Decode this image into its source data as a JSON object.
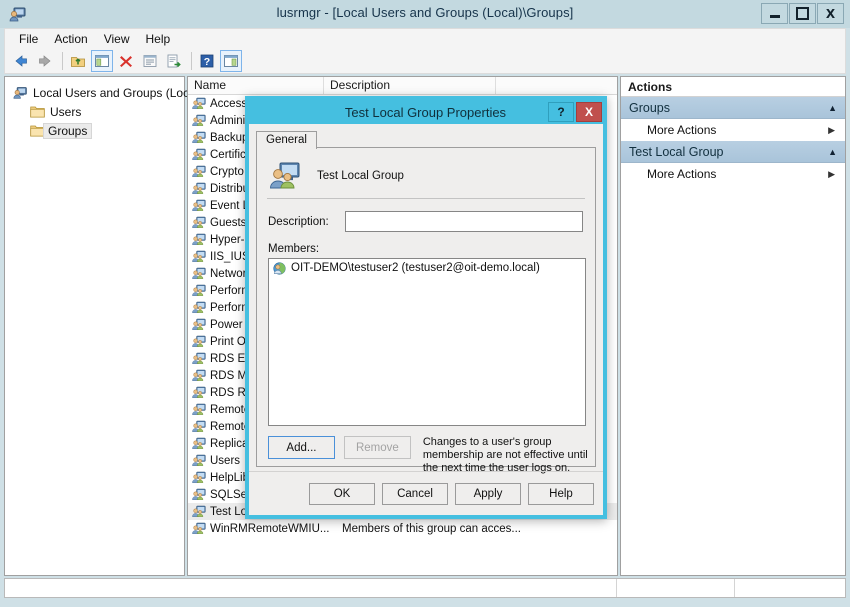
{
  "window": {
    "title": "lusrmgr - [Local Users and Groups (Local)\\Groups]",
    "icon": "users-computer-icon",
    "minimize_label": "Minimize",
    "maximize_label": "Maximize",
    "close_label": "X"
  },
  "menubar": {
    "items": [
      {
        "label": "File"
      },
      {
        "label": "Action"
      },
      {
        "label": "View"
      },
      {
        "label": "Help"
      }
    ]
  },
  "toolbar": {
    "buttons": [
      {
        "name": "back-icon",
        "label": "Back"
      },
      {
        "name": "forward-icon",
        "label": "Forward"
      },
      {
        "name": "up-one-level-icon",
        "label": "Up One Level"
      },
      {
        "name": "show-hide-console-tree-icon",
        "label": "Show/Hide Console Tree"
      },
      {
        "name": "delete-icon",
        "label": "Delete"
      },
      {
        "name": "properties-icon",
        "label": "Properties"
      },
      {
        "name": "export-list-icon",
        "label": "Export List"
      },
      {
        "name": "help-icon",
        "label": "Help"
      },
      {
        "name": "refresh-icon",
        "label": "Refresh"
      }
    ]
  },
  "tree": {
    "root": {
      "label": "Local Users and Groups (Local)",
      "icon": "users-computer-icon"
    },
    "children": [
      {
        "label": "Users",
        "icon": "folder-icon",
        "selected": false
      },
      {
        "label": "Groups",
        "icon": "folder-icon",
        "selected": true
      }
    ]
  },
  "list": {
    "columns": [
      {
        "label": "Name"
      },
      {
        "label": "Description"
      }
    ],
    "rows": [
      {
        "name": "Access",
        "description": "",
        "selected": false
      },
      {
        "name": "Admini",
        "description": "",
        "selected": false
      },
      {
        "name": "Backup",
        "description": "",
        "selected": false
      },
      {
        "name": "Certific",
        "description": "",
        "selected": false
      },
      {
        "name": "Crypto",
        "description": "",
        "selected": false
      },
      {
        "name": "Distribu",
        "description": "",
        "selected": false
      },
      {
        "name": "Event L",
        "description": "",
        "selected": false
      },
      {
        "name": "Guests",
        "description": "",
        "selected": false
      },
      {
        "name": "Hyper-",
        "description": "",
        "selected": false
      },
      {
        "name": "IIS_IUSR",
        "description": "",
        "selected": false
      },
      {
        "name": "Networ",
        "description": "",
        "selected": false
      },
      {
        "name": "Perform",
        "description": "",
        "selected": false
      },
      {
        "name": "Perform",
        "description": "",
        "selected": false
      },
      {
        "name": "Power ",
        "description": "",
        "selected": false
      },
      {
        "name": "Print O",
        "description": "",
        "selected": false
      },
      {
        "name": "RDS En",
        "description": "",
        "selected": false
      },
      {
        "name": "RDS Ma",
        "description": "",
        "selected": false
      },
      {
        "name": "RDS Re",
        "description": "",
        "selected": false
      },
      {
        "name": "Remote",
        "description": "",
        "selected": false
      },
      {
        "name": "Remote",
        "description": "",
        "selected": false
      },
      {
        "name": "Replica",
        "description": "",
        "selected": false
      },
      {
        "name": "Users",
        "description": "",
        "selected": false
      },
      {
        "name": "HelpLib",
        "description": "",
        "selected": false
      },
      {
        "name": "SQLSer",
        "description": "",
        "selected": false
      },
      {
        "name": "Test Local Group",
        "description": "",
        "selected": true
      },
      {
        "name": "WinRMRemoteWMIU...",
        "description": "Members of this group can acces...",
        "selected": false
      }
    ]
  },
  "actions": {
    "title": "Actions",
    "sections": [
      {
        "label": "Groups",
        "collapse_icon": "chevron-up-icon",
        "items": [
          {
            "label": "More Actions",
            "submenu_icon": "chevron-right-icon"
          }
        ]
      },
      {
        "label": "Test Local Group",
        "collapse_icon": "chevron-up-icon",
        "items": [
          {
            "label": "More Actions",
            "submenu_icon": "chevron-right-icon"
          }
        ]
      }
    ]
  },
  "dialog": {
    "title": "Test Local Group Properties",
    "help_button": "?",
    "close_button": "X",
    "tabs": [
      {
        "label": "General",
        "active": true
      }
    ],
    "group_icon": "group-icon",
    "group_name": "Test Local Group",
    "description": {
      "label": "Description:",
      "value": "",
      "placeholder": ""
    },
    "members": {
      "label": "Members:",
      "entries": [
        {
          "icon": "user-icon",
          "label": "OIT-DEMO\\testuser2 (testuser2@oit-demo.local)"
        }
      ]
    },
    "add_button": "Add...",
    "remove_button": "Remove",
    "remove_disabled": true,
    "note": "Changes to a user's group membership are not effective until the next time the user logs on.",
    "footer_buttons": [
      {
        "label": "OK"
      },
      {
        "label": "Cancel"
      },
      {
        "label": "Apply"
      },
      {
        "label": "Help"
      }
    ]
  },
  "statusbar": {
    "pane1": "",
    "pane2": "",
    "pane3": ""
  },
  "colors": {
    "titlebar": "#c3d9e0",
    "dialog_border": "#45bfe0",
    "dialog_close": "#c0504d",
    "actions_header": "#b0c8dd",
    "selection": "#ebebeb"
  }
}
